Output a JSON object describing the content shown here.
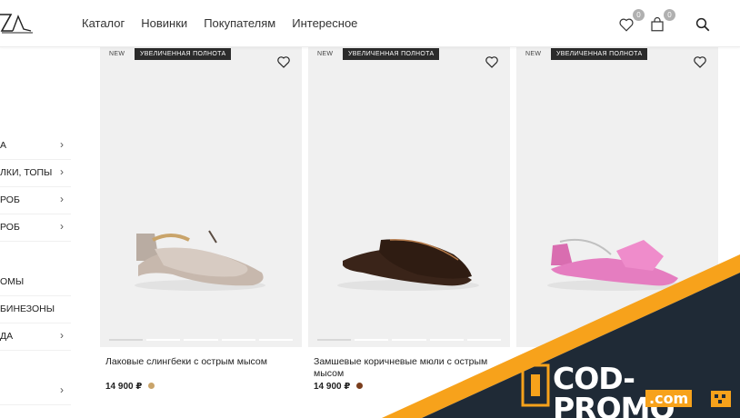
{
  "header": {
    "logo_text": "ZA",
    "nav": [
      "Каталог",
      "Новинки",
      "Покупателям",
      "Интересное"
    ],
    "wishlist_count": "0",
    "cart_count": "0"
  },
  "sidebar": {
    "items": [
      {
        "label": "А",
        "chevron": "›"
      },
      {
        "label": "ЛКИ, ТОПЫ",
        "chevron": "›"
      },
      {
        "label": "РОБ",
        "chevron": "›"
      },
      {
        "label": "РОБ",
        "chevron": "›"
      },
      {
        "label": "ОМЫ",
        "chevron": ""
      },
      {
        "label": "БИНЕЗОНЫ",
        "chevron": ""
      },
      {
        "label": "ДА",
        "chevron": "›"
      },
      {
        "label": "",
        "chevron": "›"
      }
    ]
  },
  "products": [
    {
      "tag_new": "NEW",
      "tag_full": "УВЕЛИЧЕННАЯ ПОЛНОТА",
      "name": "Лаковые слингбеки с острым мысом",
      "price": "14 900 ₽",
      "swatch": "#c9a46a"
    },
    {
      "tag_new": "NEW",
      "tag_full": "УВЕЛИЧЕННАЯ ПОЛНОТА",
      "name": "Замшевые коричневые мюли с острым мысом",
      "price": "14 900 ₽",
      "swatch": "#7a3e1d"
    },
    {
      "tag_new": "NEW",
      "tag_full": "УВЕЛИЧЕННАЯ ПОЛНОТА",
      "name": "",
      "price": "",
      "swatch": ""
    }
  ],
  "promo": {
    "brand": "COD-PROMO",
    "domain": ".com",
    "colors": {
      "dark": "#1f2a36",
      "orange": "#f7a21b"
    }
  }
}
